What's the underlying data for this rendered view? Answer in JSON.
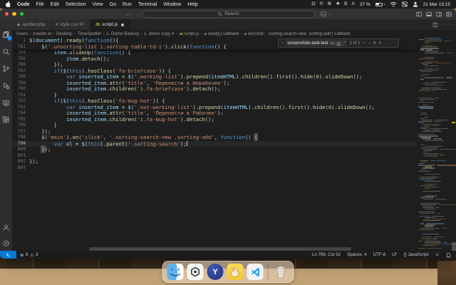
{
  "colors": {
    "accent": "#0078d4",
    "editor_bg": "#1e1e1e",
    "menubar_bg": "#1d1d1f",
    "statusbar_remote_bg": "#0078d4"
  },
  "menubar": {
    "items": [
      "Code",
      "File",
      "Edit",
      "Selection",
      "View",
      "Go",
      "Run",
      "Terminal",
      "Window",
      "Help"
    ],
    "tray_icons": [
      {
        "name": "lock-icon",
        "glyph": "⊡"
      },
      {
        "name": "copyright-icon",
        "glyph": "©"
      },
      {
        "name": "gear-icon",
        "glyph": "⚙"
      },
      {
        "name": "paw-icon",
        "glyph": "❖"
      },
      {
        "name": "letter-b-icon",
        "glyph": "B"
      },
      {
        "name": "input-source-icon",
        "glyph": "A"
      }
    ],
    "battery_label": "37 %",
    "battery_level": 0.37,
    "clock": "21 Mar 15:15"
  },
  "titlebar": {
    "search_placeholder": "Search"
  },
  "tabs": [
    {
      "label": "spotter.php",
      "icon": "php-file-icon",
      "icon_glyph": "◆",
      "icon_color": "#8993be",
      "active": false,
      "modified": false
    },
    {
      "label": "style.css 9+",
      "icon": "css-file-icon",
      "icon_glyph": "#",
      "icon_color": "#519aba",
      "active": false,
      "modified": false
    },
    {
      "label": "script.js",
      "icon": "js-file-icon",
      "icon_glyph": "JS",
      "icon_color": "#cbcb41",
      "active": true,
      "modified": true
    }
  ],
  "breadcrumbs": [
    {
      "label": "Users"
    },
    {
      "label": "master-al"
    },
    {
      "label": "Desktop"
    },
    {
      "label": "TimeSpotter"
    },
    {
      "label": "1. Demo Backup"
    },
    {
      "label": "1. demo copy 4"
    },
    {
      "label": "script.js",
      "icon": "js"
    },
    {
      "label": "ready() callback",
      "icon": "sym"
    },
    {
      "label": "on('click', '.sorting-search-new .sorting-add') callback",
      "icon": "sym"
    }
  ],
  "find": {
    "query": "screenshots-task-text",
    "match_case": "Aa",
    "whole_word": "ab",
    "regex": ".*",
    "results": "1 of 1"
  },
  "activitybar": {
    "explorer_badge": "1"
  },
  "editor": {
    "sticky": [
      {
        "n": "1",
        "t": [
          [
            "var",
            "$"
          ],
          [
            "pun",
            "("
          ],
          [
            "var",
            "document"
          ],
          [
            "pun",
            ")."
          ],
          [
            "fn",
            "ready"
          ],
          [
            "pun",
            "("
          ],
          [
            "kw",
            "function"
          ],
          [
            "pun",
            "(){"
          ]
        ]
      },
      {
        "n": "781",
        "t": [
          [
            "ws",
            "    "
          ],
          [
            "var",
            "$"
          ],
          [
            "pun",
            "("
          ],
          [
            "str",
            "'.unsorting-list i.sorting-table-td-i'"
          ],
          [
            "pun",
            ")."
          ],
          [
            "fn",
            "click"
          ],
          [
            "pun",
            "("
          ],
          [
            "kw",
            "function"
          ],
          [
            "pun",
            "() {"
          ]
        ]
      }
    ],
    "lines": [
      {
        "n": "784",
        "t": [
          [
            "ws",
            "        "
          ],
          [
            "var",
            "item"
          ],
          [
            "pun",
            "."
          ],
          [
            "fn",
            "slideUp"
          ],
          [
            "pun",
            "("
          ],
          [
            "kw",
            "function"
          ],
          [
            "pun",
            "() {"
          ]
        ]
      },
      {
        "n": "785",
        "t": [
          [
            "ws",
            "            "
          ],
          [
            "var",
            "item"
          ],
          [
            "pun",
            "."
          ],
          [
            "fn",
            "detach"
          ],
          [
            "pun",
            "();"
          ]
        ]
      },
      {
        "n": "786",
        "t": [
          [
            "ws",
            "        "
          ],
          [
            "pun",
            "});"
          ]
        ]
      },
      {
        "n": "787",
        "t": [
          [
            "ws",
            "        "
          ],
          [
            "kw",
            "if"
          ],
          [
            "pun",
            "("
          ],
          [
            "var",
            "$"
          ],
          [
            "pun",
            "("
          ],
          [
            "kw",
            "this"
          ],
          [
            "pun",
            ")."
          ],
          [
            "fn",
            "hasClass"
          ],
          [
            "pun",
            "("
          ],
          [
            "str",
            "'fa-briefcase'"
          ],
          [
            "pun",
            ")) {"
          ]
        ]
      },
      {
        "n": "788",
        "t": [
          [
            "ws",
            "            "
          ],
          [
            "kw",
            "var"
          ],
          [
            "pun",
            " "
          ],
          [
            "var",
            "inserted_item"
          ],
          [
            "pun",
            " = "
          ],
          [
            "var",
            "$"
          ],
          [
            "pun",
            "("
          ],
          [
            "str",
            "'.working-list'"
          ],
          [
            "pun",
            ")."
          ],
          [
            "fn",
            "prepend"
          ],
          [
            "pun",
            "("
          ],
          [
            "var",
            "itemHTML"
          ],
          [
            "pun",
            ")."
          ],
          [
            "fn",
            "children"
          ],
          [
            "pun",
            "()."
          ],
          [
            "fn",
            "first"
          ],
          [
            "pun",
            "()."
          ],
          [
            "fn",
            "hide"
          ],
          [
            "pun",
            "("
          ],
          [
            "num",
            "0"
          ],
          [
            "pun",
            ")."
          ],
          [
            "fn",
            "slideDown"
          ],
          [
            "pun",
            "();"
          ]
        ]
      },
      {
        "n": "789",
        "t": [
          [
            "ws",
            "            "
          ],
          [
            "var",
            "inserted_item"
          ],
          [
            "pun",
            "."
          ],
          [
            "fn",
            "attr"
          ],
          [
            "pun",
            "("
          ],
          [
            "str",
            "'title'"
          ],
          [
            "pun",
            ", "
          ],
          [
            "str",
            "'Перенести в Нерабочее'"
          ],
          [
            "pun",
            ");"
          ]
        ]
      },
      {
        "n": "790",
        "t": [
          [
            "ws",
            "            "
          ],
          [
            "var",
            "inserted_item"
          ],
          [
            "pun",
            "."
          ],
          [
            "fn",
            "children"
          ],
          [
            "pun",
            "("
          ],
          [
            "str",
            "'i.fa-briefcase'"
          ],
          [
            "pun",
            ")."
          ],
          [
            "fn",
            "detach"
          ],
          [
            "pun",
            "();"
          ]
        ]
      },
      {
        "n": "791",
        "t": [
          [
            "ws",
            "        "
          ],
          [
            "pun",
            "}"
          ]
        ]
      },
      {
        "n": "792",
        "t": [
          [
            "ws",
            "        "
          ],
          [
            "kw",
            "if"
          ],
          [
            "pun",
            "("
          ],
          [
            "var",
            "$"
          ],
          [
            "pun",
            "("
          ],
          [
            "kw",
            "this"
          ],
          [
            "pun",
            ")."
          ],
          [
            "fn",
            "hasClass"
          ],
          [
            "pun",
            "("
          ],
          [
            "str",
            "'fa-mug-hot'"
          ],
          [
            "pun",
            ")) {"
          ]
        ]
      },
      {
        "n": "793",
        "t": [
          [
            "ws",
            "            "
          ],
          [
            "kw",
            "var"
          ],
          [
            "pun",
            " "
          ],
          [
            "var",
            "inserted_item"
          ],
          [
            "pun",
            " = "
          ],
          [
            "var",
            "$"
          ],
          [
            "pun",
            "("
          ],
          [
            "str",
            "'.not-working-list'"
          ],
          [
            "pun",
            ")."
          ],
          [
            "fn",
            "prepend"
          ],
          [
            "pun",
            "("
          ],
          [
            "var",
            "itemHTML"
          ],
          [
            "pun",
            ")."
          ],
          [
            "fn",
            "children"
          ],
          [
            "pun",
            "()."
          ],
          [
            "fn",
            "first"
          ],
          [
            "pun",
            "()."
          ],
          [
            "fn",
            "hide"
          ],
          [
            "pun",
            "("
          ],
          [
            "num",
            "0"
          ],
          [
            "pun",
            ")."
          ],
          [
            "fn",
            "slideDown"
          ],
          [
            "pun",
            "();"
          ]
        ]
      },
      {
        "n": "794",
        "t": [
          [
            "ws",
            "            "
          ],
          [
            "var",
            "inserted_item"
          ],
          [
            "pun",
            "."
          ],
          [
            "fn",
            "attr"
          ],
          [
            "pun",
            "("
          ],
          [
            "str",
            "'title'"
          ],
          [
            "pun",
            ", "
          ],
          [
            "str",
            "'Перенести в Рабочее'"
          ],
          [
            "pun",
            ");"
          ]
        ]
      },
      {
        "n": "795",
        "t": [
          [
            "ws",
            "            "
          ],
          [
            "var",
            "inserted_item"
          ],
          [
            "pun",
            "."
          ],
          [
            "fn",
            "children"
          ],
          [
            "pun",
            "("
          ],
          [
            "str",
            "'i.fa-mug-hot'"
          ],
          [
            "pun",
            ")."
          ],
          [
            "fn",
            "detach"
          ],
          [
            "pun",
            "();"
          ]
        ]
      },
      {
        "n": "796",
        "t": [
          [
            "ws",
            "        "
          ],
          [
            "pun",
            "}"
          ]
        ]
      },
      {
        "n": "797",
        "t": [
          [
            "ws",
            "    "
          ],
          [
            "pun",
            "});"
          ]
        ]
      },
      {
        "n": "798",
        "t": [
          [
            "ws",
            "    "
          ],
          [
            "var",
            "$"
          ],
          [
            "pun",
            "("
          ],
          [
            "str",
            "'main'"
          ],
          [
            "pun",
            ")."
          ],
          [
            "fn",
            "on"
          ],
          [
            "pun",
            "("
          ],
          [
            "str",
            "'click'"
          ],
          [
            "pun",
            ", "
          ],
          [
            "str",
            "'.sorting-search-new .sorting-add'"
          ],
          [
            "pun",
            ", "
          ],
          [
            "kw",
            "function"
          ],
          [
            "pun",
            "() "
          ],
          [
            "brk",
            "{"
          ]
        ]
      },
      {
        "n": "799",
        "cur": true,
        "cursor": true,
        "t": [
          [
            "ws",
            "        "
          ],
          [
            "kw",
            "var"
          ],
          [
            "pun",
            " "
          ],
          [
            "var",
            "el"
          ],
          [
            "pun",
            " = "
          ],
          [
            "var",
            "$"
          ],
          [
            "pun",
            "("
          ],
          [
            "kw",
            "this"
          ],
          [
            "pun",
            ")."
          ],
          [
            "fn",
            "parent"
          ],
          [
            "pun",
            "("
          ],
          [
            "str",
            "'.sorting-search'"
          ],
          [
            "pun",
            ");"
          ]
        ]
      },
      {
        "n": "800",
        "t": [
          [
            "ws",
            "    "
          ],
          [
            "brk",
            "}"
          ],
          [
            "pun",
            ");"
          ]
        ]
      },
      {
        "n": "801",
        "t": []
      },
      {
        "n": "802",
        "t": [
          [
            "pun",
            "});"
          ]
        ]
      },
      {
        "n": "803",
        "t": []
      }
    ]
  },
  "statusbar": {
    "errors": "9",
    "warnings": "3",
    "line_col": "Ln 799, Col 52",
    "spaces": "Spaces: 4",
    "encoding": "UTF-8",
    "eol": "LF",
    "lang_glyph": "{}",
    "language": "JavaScript"
  },
  "dock": {
    "apps": [
      "Finder",
      "ChatGPT",
      "Yandex Browser",
      "Cyberduck",
      "VS Code",
      "Trash"
    ]
  }
}
